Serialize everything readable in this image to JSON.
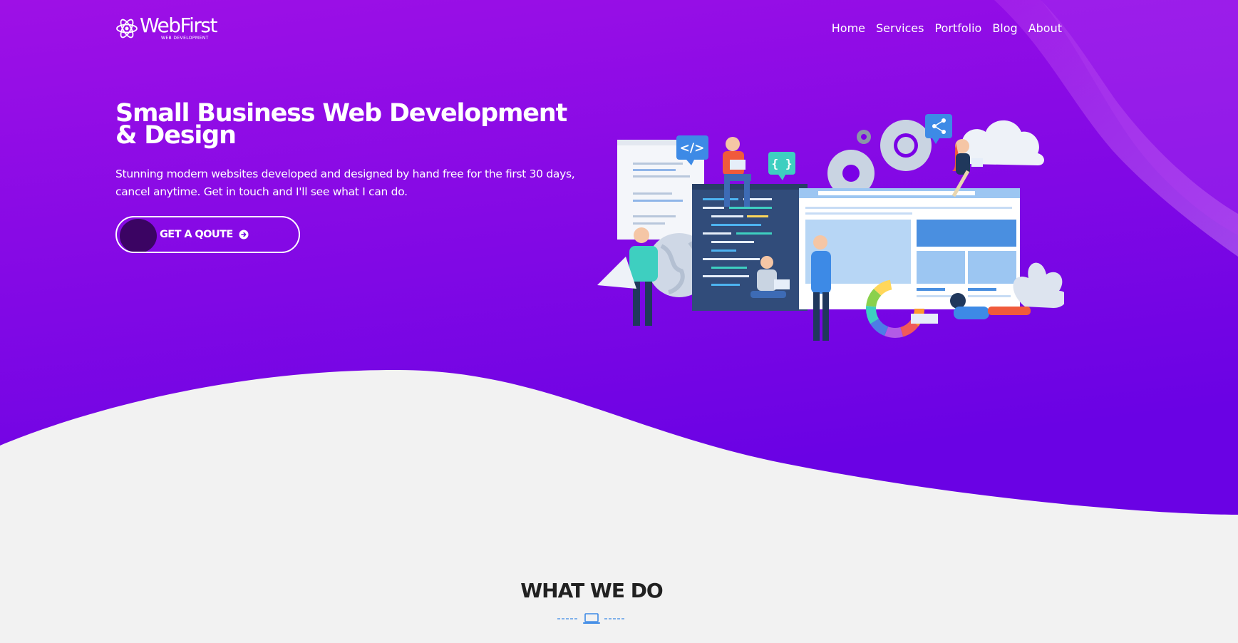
{
  "brand": {
    "name": "WebFirst",
    "tagline": "WEB DEVELOPMENT",
    "icon": "atom-icon"
  },
  "nav": {
    "items": [
      {
        "label": "Home"
      },
      {
        "label": "Services"
      },
      {
        "label": "Portfolio"
      },
      {
        "label": "Blog"
      },
      {
        "label": "About"
      }
    ]
  },
  "hero": {
    "title": "Small Business Web Development & Design",
    "description": "Stunning modern websites developed and designed by hand free for the first 30 days, cancel anytime. Get in touch and I'll see what I can do.",
    "cta_label": "GET A QOUTE",
    "cta_icon": "arrow-circle-right-icon",
    "illustration_code_tag": "</>",
    "illustration_braces": "{ }"
  },
  "section": {
    "title": "WHAT WE DO",
    "divider_icon": "laptop-icon"
  },
  "colors": {
    "hero_top": "#9b0ee6",
    "hero_bottom": "#6c02e3",
    "page_bg": "#f2f2f2",
    "button_dot": "#3b0463",
    "accent_blue": "#3d8ae6",
    "title_text": "#212121"
  }
}
